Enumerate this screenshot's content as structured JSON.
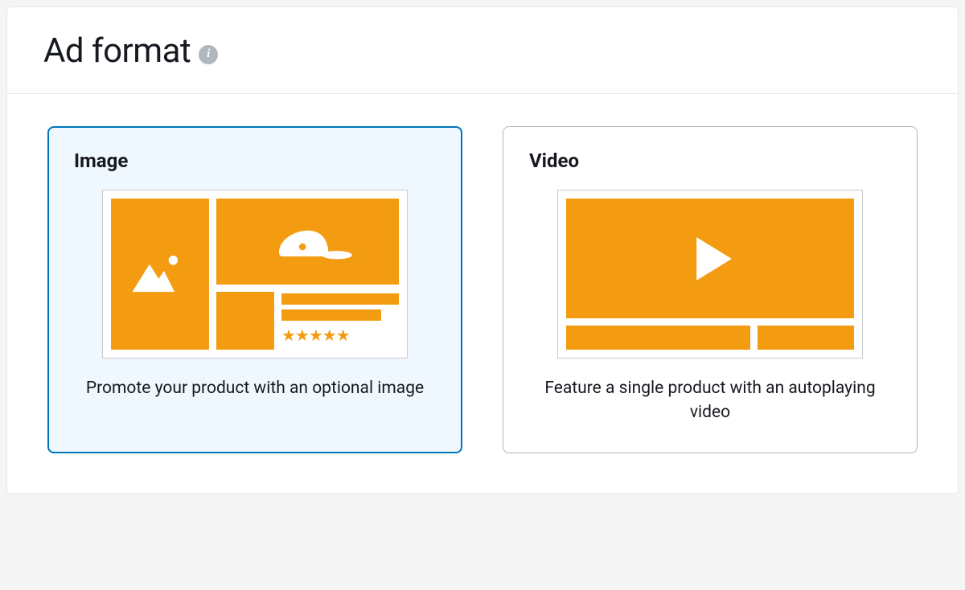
{
  "section": {
    "title": "Ad format"
  },
  "options": {
    "image": {
      "title": "Image",
      "description": "Promote your product with an optional image",
      "selected": true
    },
    "video": {
      "title": "Video",
      "description": "Feature a single product with an autoplaying video",
      "selected": false
    }
  },
  "colors": {
    "accent": "#f39c12",
    "selection": "#0073bb",
    "selection_bg": "#f0f8ff"
  },
  "stars": "★★★★★"
}
